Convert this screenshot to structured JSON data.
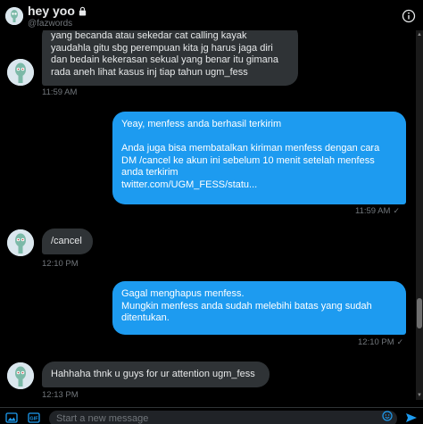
{
  "header": {
    "title": "hey yoo",
    "handle": "@fazwords"
  },
  "messages": [
    {
      "id": "m1",
      "direction": "received",
      "text": "yang becanda atau sekedar cat calling kayak\nyaudahla gitu sbg perempuan kita jg harus jaga diri\ndan bedain kekerasan sekual yang benar itu gimana\nrada aneh lihat kasus inj tiap tahun ugm_fess",
      "time": "11:59 AM"
    },
    {
      "id": "m2",
      "direction": "sent",
      "text": "Yeay, menfess anda berhasil terkirim\n\nAnda juga bisa membatalkan kiriman menfess dengan cara\nDM /cancel ke akun ini sebelum 10 menit setelah menfess\nanda terkirim\n twitter.com/UGM_FESS/statu...",
      "time": "11:59 AM"
    },
    {
      "id": "m3",
      "direction": "received",
      "text": "/cancel",
      "time": "12:10 PM"
    },
    {
      "id": "m4",
      "direction": "sent",
      "text": "Gagal menghapus menfess.\nMungkin menfess anda sudah melebihi batas yang sudah\nditentukan.",
      "time": "12:10 PM"
    },
    {
      "id": "m5",
      "direction": "received",
      "text": "Hahhaha thnk u guys for ur attention ugm_fess",
      "time": "12:13 PM"
    }
  ],
  "composer": {
    "placeholder": "Start a new message"
  },
  "icons": {
    "header_lock": "lock-icon",
    "header_info": "info-icon",
    "media": "image-icon",
    "gif": "gif-icon",
    "emoji": "emoji-icon",
    "send": "send-icon",
    "read_receipt": "checkmark-icon"
  },
  "colors": {
    "background": "#000000",
    "sent_bubble": "#1d9bf0",
    "received_bubble": "#2f3336",
    "muted_text": "#71767b"
  }
}
